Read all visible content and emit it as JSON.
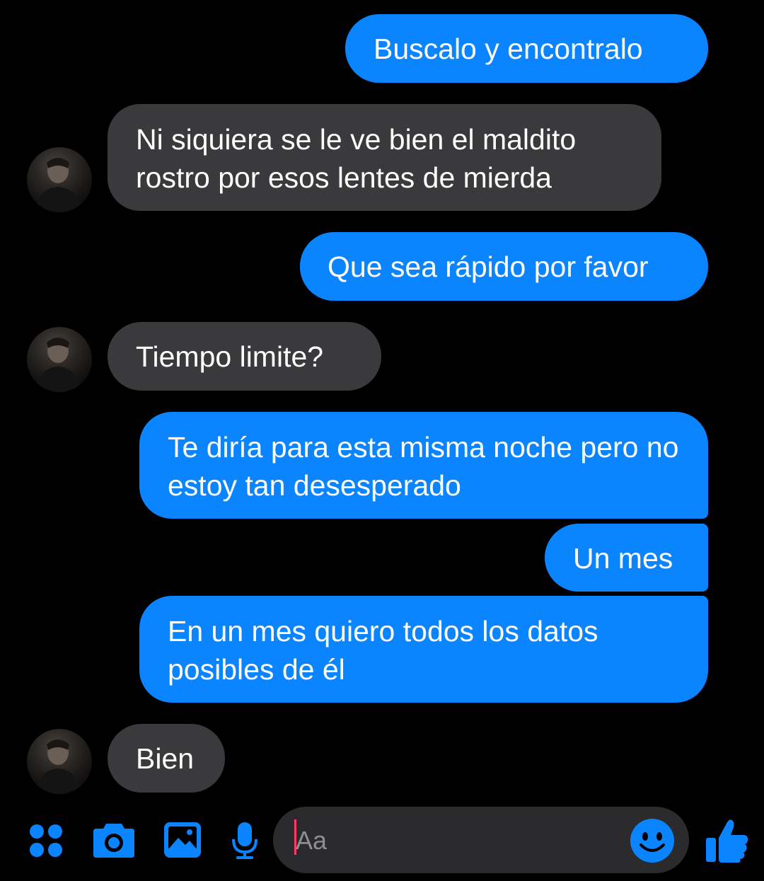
{
  "colors": {
    "background": "#000000",
    "outgoing_bubble": "#0a84ff",
    "incoming_bubble": "#3a3a3c",
    "accent": "#0a84ff",
    "input_background": "#2b2b2d",
    "cursor": "#ff3b6b"
  },
  "messages": [
    {
      "direction": "outgoing",
      "text": "Buscalo y encontralo"
    },
    {
      "direction": "incoming",
      "text": "Ni siquiera se le ve bien el maldito rostro por esos lentes de mierda",
      "avatar": "contact-avatar"
    },
    {
      "direction": "outgoing",
      "text": "Que sea rápido por favor"
    },
    {
      "direction": "incoming",
      "text": "Tiempo limite?",
      "avatar": "contact-avatar"
    },
    {
      "direction": "outgoing",
      "text": "Te diría para esta misma noche pero no estoy tan desesperado"
    },
    {
      "direction": "outgoing",
      "text": "Un mes"
    },
    {
      "direction": "outgoing",
      "text": "En un mes quiero todos los datos posibles de él"
    },
    {
      "direction": "incoming",
      "text": "Bien",
      "avatar": "contact-avatar"
    }
  ],
  "composer": {
    "placeholder": "Aa",
    "icons": [
      "apps-grid-icon",
      "camera-icon",
      "gallery-icon",
      "microphone-icon",
      "emoji-icon",
      "thumbs-up-icon"
    ]
  }
}
